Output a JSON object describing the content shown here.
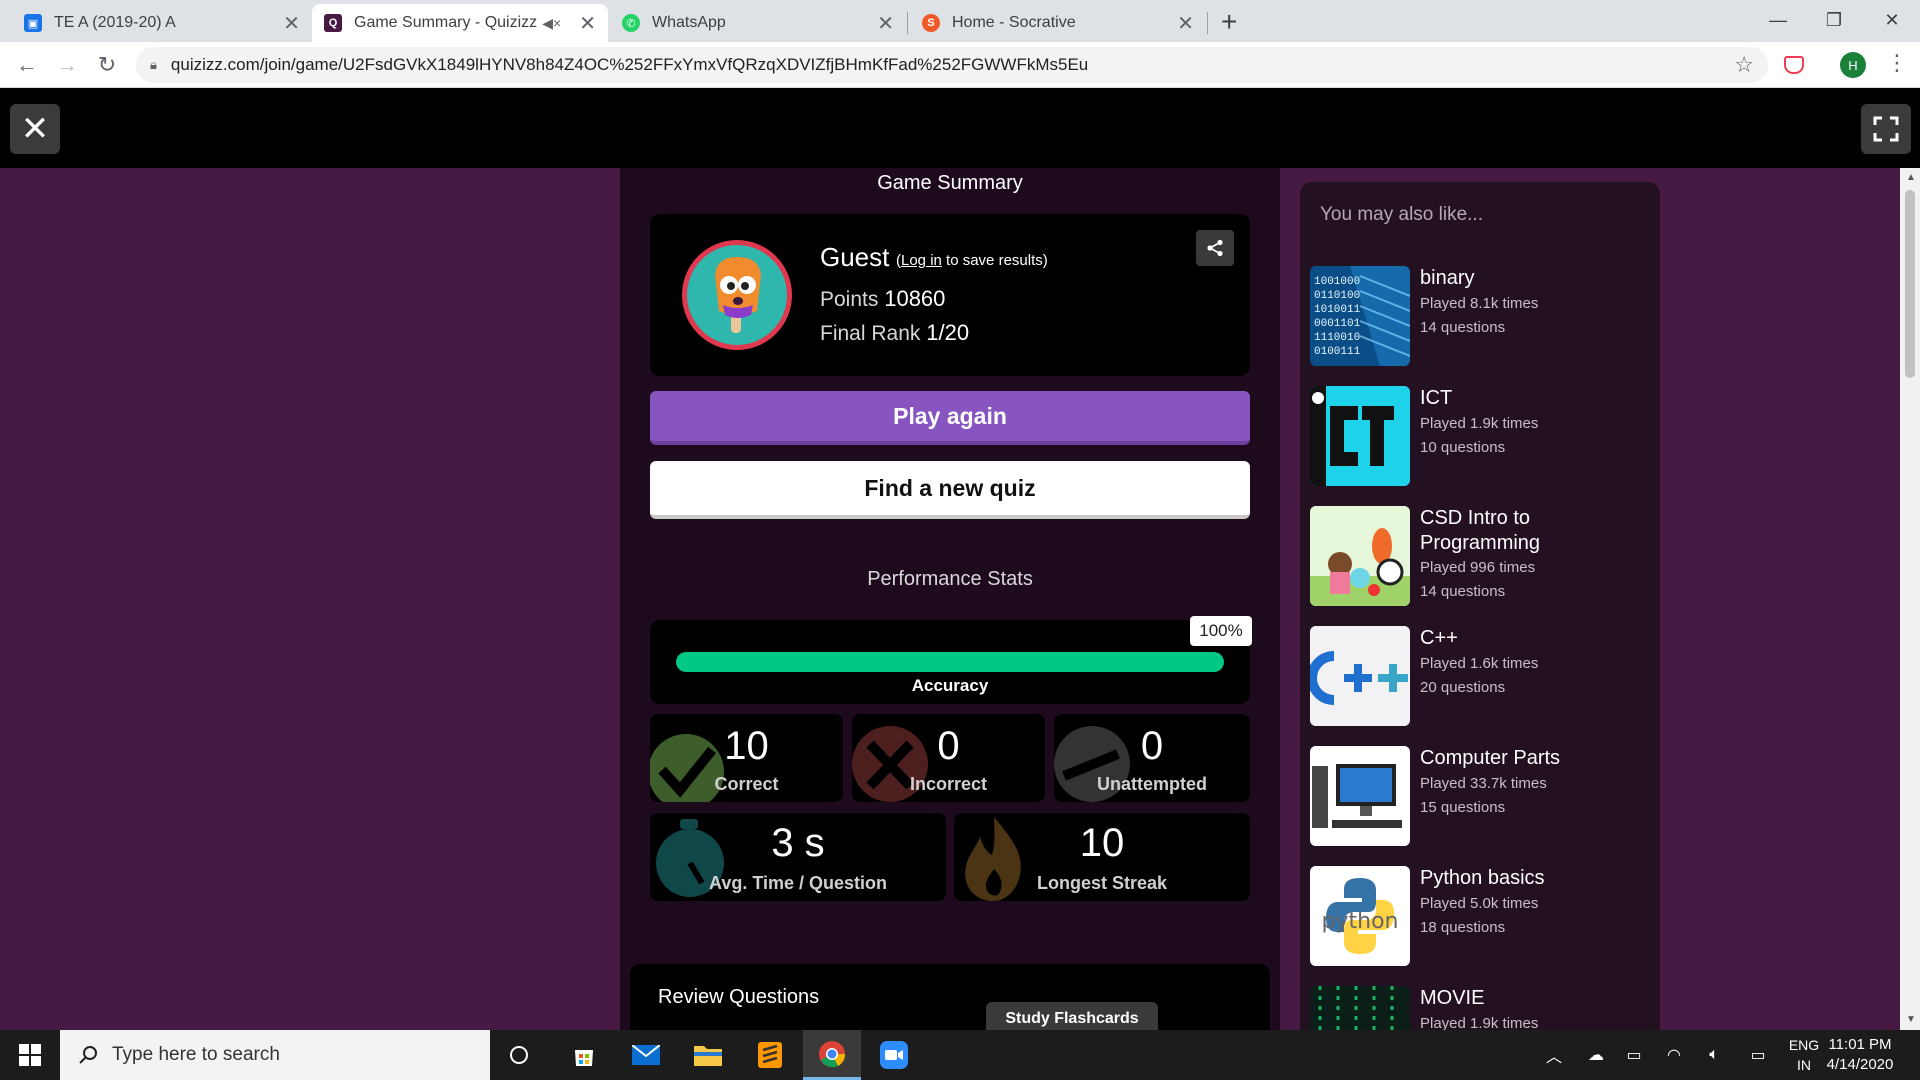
{
  "browser": {
    "tabs": [
      {
        "title": "TE A (2019-20) A",
        "color": "#1a73e8",
        "icon": "classroom-icon"
      },
      {
        "title": "Game Summary - Quizizz",
        "color": "#461a42",
        "icon": "quizizz-icon",
        "active": true
      },
      {
        "title": "WhatsApp",
        "color": "#25d366",
        "icon": "whatsapp-icon"
      },
      {
        "title": "Home - Socrative",
        "color": "#f05a28",
        "icon": "socrative-icon"
      }
    ],
    "url": "quizizz.com/join/game/U2FsdGVkX1849lHYNV8h84Z4OC%252FFxYmxVfQRzqXDVIZfjBHmKfFad%252FGWWFkMs5Eu",
    "profile_initial": "H"
  },
  "game": {
    "title": "Game Summary",
    "player_name": "Guest",
    "login_prefix": "(",
    "login_link": "Log in",
    "login_suffix": " to save results)",
    "points_label": "Points",
    "points": "10860",
    "rank_label": "Final Rank",
    "rank": "1/20",
    "play_again": "Play again",
    "find_quiz": "Find a new quiz"
  },
  "performance": {
    "title": "Performance Stats",
    "accuracy_label": "Accuracy",
    "accuracy_text": "100%",
    "accuracy_value": 1.0,
    "correct": "10",
    "correct_label": "Correct",
    "incorrect": "0",
    "incorrect_label": "Incorrect",
    "unattempted": "0",
    "unattempted_label": "Unattempted",
    "avg_time": "3 s",
    "avg_time_label": "Avg. Time / Question",
    "streak": "10",
    "streak_label": "Longest Streak"
  },
  "review": {
    "title": "Review Questions",
    "flashcards": "Study Flashcards"
  },
  "recommendations": {
    "title": "You may also like...",
    "items": [
      {
        "name": "binary",
        "played": "Played 8.1k times",
        "questions": "14 questions"
      },
      {
        "name": "ICT",
        "played": "Played 1.9k times",
        "questions": "10 questions"
      },
      {
        "name": "CSD Intro to Programming",
        "played": "Played 996 times",
        "questions": "14 questions"
      },
      {
        "name": "C++",
        "played": "Played 1.6k times",
        "questions": "20 questions"
      },
      {
        "name": "Computer Parts",
        "played": "Played 33.7k times",
        "questions": "15 questions"
      },
      {
        "name": "Python basics",
        "played": "Played 5.0k times",
        "questions": "18 questions"
      },
      {
        "name": "MOVIE",
        "played": "Played 1.9k times",
        "questions": ""
      }
    ]
  },
  "taskbar": {
    "search_placeholder": "Type here to search",
    "lang_line1": "ENG",
    "lang_line2": "IN",
    "time": "11:01 PM",
    "date": "4/14/2020"
  }
}
